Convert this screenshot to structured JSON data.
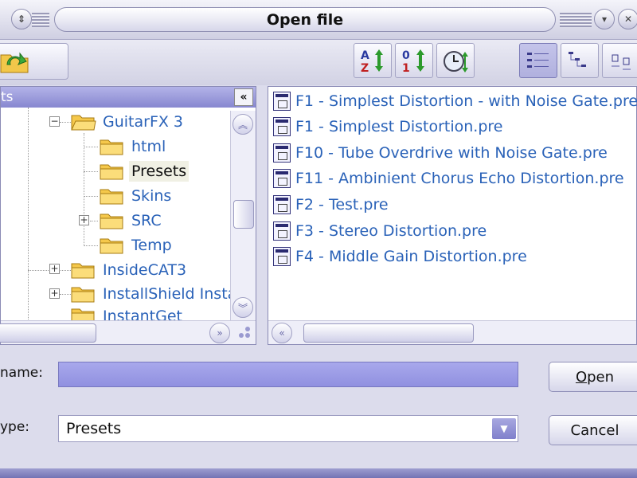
{
  "window": {
    "title": "Open file"
  },
  "icons": {
    "up_folder": "folder-up-icon",
    "sort_name": "sort-az-icon",
    "sort_size": "sort-01-icon",
    "sort_date": "clock-icon",
    "view_details": "details-view-icon",
    "view_tree": "tree-view-icon",
    "view_list": "list-view-icon"
  },
  "tree": {
    "header_label": "ts",
    "collapse_label": "«",
    "items": [
      {
        "label": "GuitarFX 3",
        "expander": "−"
      },
      {
        "label": "html"
      },
      {
        "label": "Presets",
        "selected": true
      },
      {
        "label": "Skins"
      },
      {
        "label": "SRC",
        "expander": "+"
      },
      {
        "label": "Temp"
      },
      {
        "label": "InsideCAT3",
        "expander": "+"
      },
      {
        "label": "InstallShield Instal",
        "expander": "+"
      },
      {
        "label": "InstantGet"
      }
    ]
  },
  "files": [
    "F1 - Simplest Distortion - with Noise Gate.pre",
    "F1 - Simplest Distortion.pre",
    "F10 - Tube Overdrive with Noise Gate.pre",
    "F11 - Ambinient Chorus Echo Distortion.pre",
    "F2 - Test.pre",
    "F3 - Stereo Distortion.pre",
    "F4 - Middle Gain Distortion.pre"
  ],
  "form": {
    "name_label": "name:",
    "name_value": "",
    "type_label": "ype:",
    "type_value": "Presets"
  },
  "buttons": {
    "open_access_key": "O",
    "open_rest": "pen",
    "cancel": "Cancel"
  },
  "colors": {
    "accent": "#8787d0",
    "link_text": "#2a62b8"
  }
}
